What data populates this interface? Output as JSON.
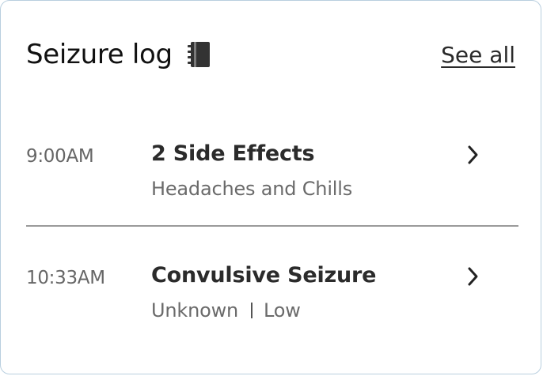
{
  "header": {
    "title": "Seizure log",
    "title_icon": "notebook-icon",
    "see_all_label": "See all"
  },
  "entries": [
    {
      "time": "9:00AM",
      "title": "2 Side Effects",
      "subtitle_parts": [
        "Headaches and Chills"
      ],
      "action_icon": "chevron-right-icon"
    },
    {
      "time": "10:33AM",
      "title": "Convulsive Seizure",
      "subtitle_parts": [
        "Unknown",
        "Low"
      ],
      "action_icon": "chevron-right-icon"
    }
  ],
  "colors": {
    "card_border": "#b9cfdf",
    "title_text": "#111111",
    "muted_text": "#666666",
    "divider": "#9a9a9a"
  }
}
